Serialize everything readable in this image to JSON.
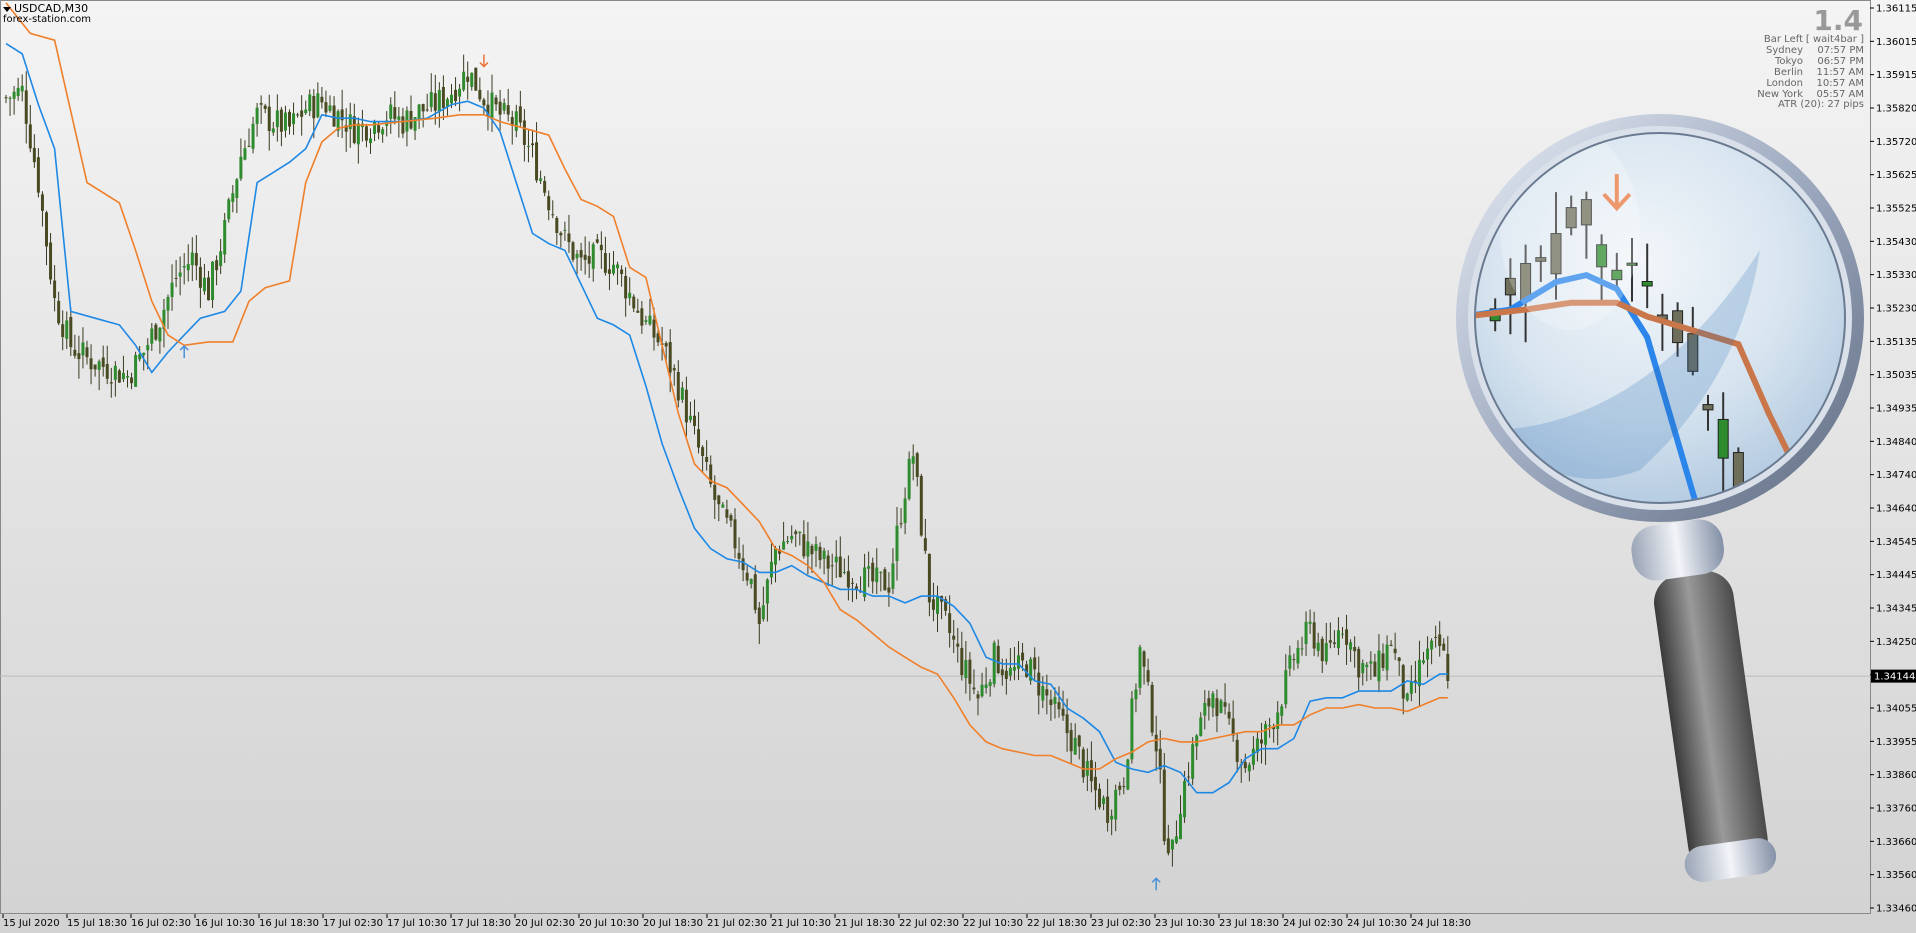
{
  "header": {
    "symbol": "USDCAD,M30",
    "watermark": "forex-station.com"
  },
  "info_panel": {
    "big_value": "1.4",
    "rows": [
      {
        "label": "Bar Left",
        "value": "[ wait4bar ]"
      },
      {
        "label": "Sydney",
        "value": "07:57 PM"
      },
      {
        "label": "Tokyo",
        "value": "06:57 PM"
      },
      {
        "label": "Berlin",
        "value": "11:57 AM"
      },
      {
        "label": "London",
        "value": "10:57 AM"
      },
      {
        "label": "New York",
        "value": "05:57 AM"
      }
    ],
    "atr": "ATR (20): 27 pips"
  },
  "price_badge": "1.34144",
  "colors": {
    "bull": "#2e8b2e",
    "bear": "#4a4a22",
    "blue_line": "#1e88e5",
    "orange_line": "#f07f2a",
    "up_arrow": "#4a90d9",
    "down_arrow": "#e8743b",
    "magnifier_ring": "#a8b4c8",
    "magnifier_handle": "#6a6a6a"
  },
  "icons": {
    "magnifier": "magnifier-icon",
    "symbol_menu": "triangle-down-icon"
  },
  "chart_data": {
    "type": "candlestick",
    "ylim": [
      1.3346,
      1.36115
    ],
    "y_ticks": [
      "1.36115",
      "1.36015",
      "1.35915",
      "1.35820",
      "1.35720",
      "1.35625",
      "1.35525",
      "1.35430",
      "1.35330",
      "1.35230",
      "1.35135",
      "1.35035",
      "1.34935",
      "1.34840",
      "1.34740",
      "1.34640",
      "1.34545",
      "1.34445",
      "1.34345",
      "1.34250",
      "1.34150",
      "1.34055",
      "1.33955",
      "1.33860",
      "1.33760",
      "1.33660",
      "1.33560",
      "1.33460"
    ],
    "x_labels": [
      "15 Jul 2020",
      "15 Jul 18:30",
      "16 Jul 02:30",
      "16 Jul 10:30",
      "16 Jul 18:30",
      "17 Jul 02:30",
      "17 Jul 10:30",
      "17 Jul 18:30",
      "20 Jul 02:30",
      "20 Jul 10:30",
      "20 Jul 18:30",
      "21 Jul 02:30",
      "21 Jul 10:30",
      "21 Jul 18:30",
      "22 Jul 02:30",
      "22 Jul 10:30",
      "22 Jul 18:30",
      "23 Jul 02:30",
      "23 Jul 10:30",
      "23 Jul 18:30",
      "24 Jul 02:30",
      "24 Jul 10:30",
      "24 Jul 18:30"
    ],
    "close_path": [
      [
        0,
        1.3585
      ],
      [
        4,
        1.3587
      ],
      [
        8,
        1.356
      ],
      [
        12,
        1.3525
      ],
      [
        16,
        1.3512
      ],
      [
        20,
        1.3508
      ],
      [
        24,
        1.3506
      ],
      [
        28,
        1.3504
      ],
      [
        30,
        1.3503
      ],
      [
        34,
        1.351
      ],
      [
        38,
        1.352
      ],
      [
        42,
        1.3532
      ],
      [
        46,
        1.3538
      ],
      [
        50,
        1.3528
      ],
      [
        54,
        1.3546
      ],
      [
        58,
        1.3568
      ],
      [
        62,
        1.358
      ],
      [
        66,
        1.3578
      ],
      [
        70,
        1.3576
      ],
      [
        74,
        1.3582
      ],
      [
        78,
        1.3584
      ],
      [
        82,
        1.358
      ],
      [
        86,
        1.3576
      ],
      [
        90,
        1.3577
      ],
      [
        94,
        1.358
      ],
      [
        98,
        1.3578
      ],
      [
        102,
        1.3581
      ],
      [
        106,
        1.3583
      ],
      [
        110,
        1.3587
      ],
      [
        114,
        1.3593
      ],
      [
        118,
        1.3585
      ],
      [
        122,
        1.358
      ],
      [
        126,
        1.3577
      ],
      [
        130,
        1.3568
      ],
      [
        134,
        1.3555
      ],
      [
        138,
        1.3543
      ],
      [
        142,
        1.3536
      ],
      [
        146,
        1.3538
      ],
      [
        150,
        1.3536
      ],
      [
        154,
        1.3527
      ],
      [
        158,
        1.3518
      ],
      [
        162,
        1.3512
      ],
      [
        166,
        1.35
      ],
      [
        170,
        1.3485
      ],
      [
        174,
        1.347
      ],
      [
        176,
        1.3463
      ],
      [
        180,
        1.3454
      ],
      [
        184,
        1.3442
      ],
      [
        186,
        1.343
      ],
      [
        190,
        1.3452
      ],
      [
        194,
        1.3456
      ],
      [
        198,
        1.3452
      ],
      [
        202,
        1.3448
      ],
      [
        206,
        1.3446
      ],
      [
        210,
        1.3444
      ],
      [
        214,
        1.3442
      ],
      [
        218,
        1.3442
      ],
      [
        222,
        1.347
      ],
      [
        224,
        1.348
      ],
      [
        228,
        1.3438
      ],
      [
        232,
        1.343
      ],
      [
        236,
        1.3418
      ],
      [
        240,
        1.3408
      ],
      [
        244,
        1.342
      ],
      [
        248,
        1.3415
      ],
      [
        252,
        1.3418
      ],
      [
        256,
        1.341
      ],
      [
        260,
        1.3402
      ],
      [
        264,
        1.3394
      ],
      [
        268,
        1.3382
      ],
      [
        272,
        1.3375
      ],
      [
        276,
        1.3385
      ],
      [
        280,
        1.3422
      ],
      [
        284,
        1.3395
      ],
      [
        286,
        1.337
      ],
      [
        288,
        1.3362
      ],
      [
        290,
        1.3378
      ],
      [
        294,
        1.3397
      ],
      [
        298,
        1.341
      ],
      [
        302,
        1.3398
      ],
      [
        306,
        1.3388
      ],
      [
        310,
        1.3395
      ],
      [
        314,
        1.3405
      ],
      [
        318,
        1.342
      ],
      [
        322,
        1.3428
      ],
      [
        326,
        1.342
      ],
      [
        330,
        1.343
      ],
      [
        334,
        1.3418
      ],
      [
        338,
        1.3415
      ],
      [
        342,
        1.3425
      ],
      [
        346,
        1.3405
      ],
      [
        350,
        1.342
      ],
      [
        354,
        1.3423
      ],
      [
        356,
        1.3416
      ]
    ],
    "n_bars": 357,
    "series": [
      {
        "kind": "line",
        "color_key": "blue_line",
        "points": [
          [
            0,
            1.3601
          ],
          [
            4,
            1.3598
          ],
          [
            8,
            1.3583
          ],
          [
            12,
            1.357
          ],
          [
            16,
            1.3522
          ],
          [
            22,
            1.352
          ],
          [
            28,
            1.3518
          ],
          [
            32,
            1.3512
          ],
          [
            36,
            1.3504
          ],
          [
            40,
            1.351
          ],
          [
            44,
            1.3515
          ],
          [
            48,
            1.352
          ],
          [
            54,
            1.3522
          ],
          [
            58,
            1.3528
          ],
          [
            62,
            1.356
          ],
          [
            66,
            1.3563
          ],
          [
            70,
            1.3566
          ],
          [
            74,
            1.357
          ],
          [
            78,
            1.358
          ],
          [
            82,
            1.3579
          ],
          [
            86,
            1.3579
          ],
          [
            90,
            1.3578
          ],
          [
            94,
            1.3578
          ],
          [
            98,
            1.3578
          ],
          [
            104,
            1.3579
          ],
          [
            110,
            1.3583
          ],
          [
            114,
            1.3584
          ],
          [
            118,
            1.3582
          ],
          [
            122,
            1.3575
          ],
          [
            126,
            1.356
          ],
          [
            130,
            1.3545
          ],
          [
            134,
            1.3542
          ],
          [
            138,
            1.354
          ],
          [
            142,
            1.353
          ],
          [
            146,
            1.352
          ],
          [
            150,
            1.3518
          ],
          [
            154,
            1.3515
          ],
          [
            158,
            1.35
          ],
          [
            162,
            1.3483
          ],
          [
            166,
            1.347
          ],
          [
            170,
            1.3458
          ],
          [
            174,
            1.3452
          ],
          [
            178,
            1.3449
          ],
          [
            182,
            1.3448
          ],
          [
            186,
            1.3445
          ],
          [
            190,
            1.3445
          ],
          [
            194,
            1.3447
          ],
          [
            198,
            1.3444
          ],
          [
            202,
            1.3442
          ],
          [
            206,
            1.344
          ],
          [
            210,
            1.344
          ],
          [
            214,
            1.3438
          ],
          [
            218,
            1.3438
          ],
          [
            222,
            1.3436
          ],
          [
            226,
            1.3438
          ],
          [
            230,
            1.3438
          ],
          [
            234,
            1.3435
          ],
          [
            238,
            1.343
          ],
          [
            242,
            1.342
          ],
          [
            246,
            1.3418
          ],
          [
            250,
            1.3418
          ],
          [
            254,
            1.3413
          ],
          [
            258,
            1.3412
          ],
          [
            262,
            1.3405
          ],
          [
            266,
            1.3402
          ],
          [
            270,
            1.3398
          ],
          [
            274,
            1.3389
          ],
          [
            278,
            1.3387
          ],
          [
            282,
            1.3386
          ],
          [
            286,
            1.3388
          ],
          [
            290,
            1.3386
          ],
          [
            294,
            1.338
          ],
          [
            298,
            1.338
          ],
          [
            302,
            1.3383
          ],
          [
            306,
            1.339
          ],
          [
            310,
            1.3393
          ],
          [
            314,
            1.3393
          ],
          [
            318,
            1.3396
          ],
          [
            322,
            1.3407
          ],
          [
            326,
            1.3408
          ],
          [
            330,
            1.3408
          ],
          [
            334,
            1.341
          ],
          [
            338,
            1.341
          ],
          [
            342,
            1.341
          ],
          [
            346,
            1.3413
          ],
          [
            350,
            1.3412
          ],
          [
            354,
            1.3415
          ],
          [
            356,
            1.3415
          ]
        ]
      },
      {
        "kind": "line",
        "color_key": "orange_line",
        "points": [
          [
            0,
            1.3613
          ],
          [
            6,
            1.3604
          ],
          [
            12,
            1.3602
          ],
          [
            16,
            1.3581
          ],
          [
            20,
            1.356
          ],
          [
            28,
            1.3554
          ],
          [
            32,
            1.354
          ],
          [
            36,
            1.3525
          ],
          [
            40,
            1.3515
          ],
          [
            44,
            1.3512
          ],
          [
            50,
            1.3513
          ],
          [
            56,
            1.3513
          ],
          [
            60,
            1.3525
          ],
          [
            64,
            1.3529
          ],
          [
            70,
            1.3531
          ],
          [
            74,
            1.356
          ],
          [
            78,
            1.3572
          ],
          [
            82,
            1.3576
          ],
          [
            86,
            1.3577
          ],
          [
            90,
            1.3577
          ],
          [
            98,
            1.3578
          ],
          [
            106,
            1.3579
          ],
          [
            112,
            1.358
          ],
          [
            118,
            1.358
          ],
          [
            122,
            1.3578
          ],
          [
            128,
            1.3576
          ],
          [
            134,
            1.3574
          ],
          [
            138,
            1.3564
          ],
          [
            142,
            1.3555
          ],
          [
            146,
            1.3553
          ],
          [
            150,
            1.355
          ],
          [
            154,
            1.3535
          ],
          [
            158,
            1.3532
          ],
          [
            162,
            1.3512
          ],
          [
            166,
            1.3492
          ],
          [
            170,
            1.3477
          ],
          [
            174,
            1.3472
          ],
          [
            178,
            1.347
          ],
          [
            182,
            1.3465
          ],
          [
            186,
            1.346
          ],
          [
            190,
            1.3452
          ],
          [
            194,
            1.345
          ],
          [
            198,
            1.3447
          ],
          [
            202,
            1.3442
          ],
          [
            206,
            1.3434
          ],
          [
            210,
            1.3431
          ],
          [
            214,
            1.3427
          ],
          [
            218,
            1.3423
          ],
          [
            222,
            1.342
          ],
          [
            226,
            1.3417
          ],
          [
            230,
            1.3415
          ],
          [
            234,
            1.3408
          ],
          [
            238,
            1.34
          ],
          [
            242,
            1.3395
          ],
          [
            246,
            1.3393
          ],
          [
            250,
            1.3392
          ],
          [
            254,
            1.3391
          ],
          [
            258,
            1.3391
          ],
          [
            262,
            1.3389
          ],
          [
            266,
            1.3387
          ],
          [
            270,
            1.3387
          ],
          [
            274,
            1.339
          ],
          [
            278,
            1.3392
          ],
          [
            282,
            1.3395
          ],
          [
            286,
            1.3396
          ],
          [
            290,
            1.3395
          ],
          [
            294,
            1.3395
          ],
          [
            298,
            1.3396
          ],
          [
            302,
            1.3397
          ],
          [
            306,
            1.3398
          ],
          [
            310,
            1.3398
          ],
          [
            314,
            1.34
          ],
          [
            318,
            1.34
          ],
          [
            322,
            1.3403
          ],
          [
            326,
            1.3405
          ],
          [
            330,
            1.3405
          ],
          [
            334,
            1.3406
          ],
          [
            338,
            1.3405
          ],
          [
            342,
            1.3405
          ],
          [
            346,
            1.3404
          ],
          [
            350,
            1.3406
          ],
          [
            354,
            1.3408
          ],
          [
            356,
            1.3408
          ]
        ]
      }
    ],
    "arrows": [
      {
        "bar": 44,
        "price": 1.351,
        "dir": "up"
      },
      {
        "bar": 118,
        "price": 1.3596,
        "dir": "down"
      },
      {
        "bar": 284,
        "price": 1.3353,
        "dir": "up"
      }
    ],
    "price_line": 1.34144
  }
}
